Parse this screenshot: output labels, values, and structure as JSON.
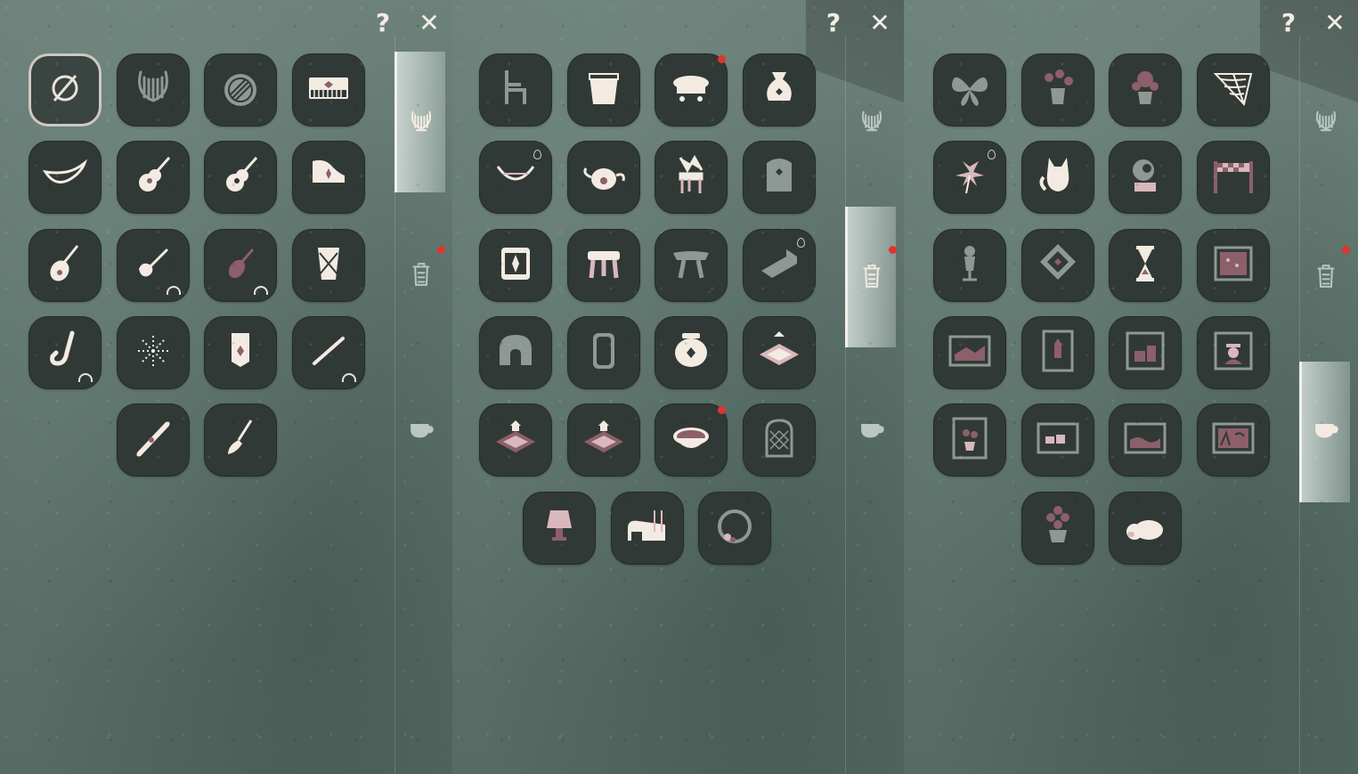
{
  "colors": {
    "background": "#5f756e",
    "slot": "#313936",
    "icon_light": "#f3ebe2",
    "icon_pink": "#d8b7bd",
    "icon_mauve": "#8c5f6b",
    "notification": "#e0342e"
  },
  "panels": [
    {
      "help_label": "?",
      "close_label": "✕",
      "active_tab": 0,
      "tabs": [
        {
          "icon": "lyre-icon",
          "notification": false
        },
        {
          "icon": "trash-can-icon",
          "notification": true
        },
        {
          "icon": "teacup-icon",
          "notification": false
        }
      ],
      "items": [
        {
          "icon": "none-icon",
          "selected": true
        },
        {
          "icon": "lyre-icon"
        },
        {
          "icon": "drum-icon"
        },
        {
          "icon": "keyboard-icon"
        },
        {
          "icon": "horn-icon"
        },
        {
          "icon": "guitar-icon"
        },
        {
          "icon": "guitar-icon"
        },
        {
          "icon": "grand-piano-icon"
        },
        {
          "icon": "pipa-icon"
        },
        {
          "icon": "electric-guitar-icon",
          "corner_mark": true
        },
        {
          "icon": "violin-icon",
          "corner_mark": true
        },
        {
          "icon": "hand-drum-icon"
        },
        {
          "icon": "saxophone-icon",
          "corner_mark": true
        },
        {
          "icon": "firework-icon"
        },
        {
          "icon": "lantern-icon"
        },
        {
          "icon": "flute-icon",
          "corner_mark": true
        },
        {
          "icon": "snowboard-icon"
        },
        {
          "icon": "broom-icon"
        }
      ]
    },
    {
      "help_label": "?",
      "close_label": "✕",
      "active_tab": 1,
      "tabs": [
        {
          "icon": "lyre-icon",
          "notification": false
        },
        {
          "icon": "trash-can-icon",
          "notification": true
        },
        {
          "icon": "teacup-icon",
          "notification": false
        }
      ],
      "items": [
        {
          "icon": "chair-icon"
        },
        {
          "icon": "cup-icon"
        },
        {
          "icon": "table-icon",
          "notification": true
        },
        {
          "icon": "sack-icon"
        },
        {
          "icon": "hammock-icon",
          "drop": true
        },
        {
          "icon": "teapot-icon",
          "sun_mark": true
        },
        {
          "icon": "ornate-chair-icon"
        },
        {
          "icon": "cabinet-icon"
        },
        {
          "icon": "barrel-drum-icon"
        },
        {
          "icon": "stool-icon"
        },
        {
          "icon": "bench-icon"
        },
        {
          "icon": "bed-frame-icon",
          "drop": true
        },
        {
          "icon": "igloo-icon"
        },
        {
          "icon": "mirror-icon"
        },
        {
          "icon": "jar-icon"
        },
        {
          "icon": "cushion-up-icon"
        },
        {
          "icon": "box-up-icon"
        },
        {
          "icon": "box-up-icon"
        },
        {
          "icon": "bowl-icon",
          "notification": true
        },
        {
          "icon": "arched-window-icon"
        },
        {
          "icon": "lamp-icon"
        },
        {
          "icon": "bed-icon"
        },
        {
          "icon": "wreath-icon"
        }
      ]
    },
    {
      "help_label": "?",
      "close_label": "✕",
      "active_tab": 2,
      "tabs": [
        {
          "icon": "lyre-icon",
          "notification": false
        },
        {
          "icon": "trash-can-icon",
          "notification": true
        },
        {
          "icon": "teacup-icon",
          "notification": false
        }
      ],
      "items": [
        {
          "icon": "butterfly-icon"
        },
        {
          "icon": "flower-vase-icon"
        },
        {
          "icon": "sunflower-vase-icon"
        },
        {
          "icon": "spiderweb-icon"
        },
        {
          "icon": "pinwheel-icon",
          "drop": true
        },
        {
          "icon": "fox-icon"
        },
        {
          "icon": "gramophone-icon"
        },
        {
          "icon": "banner-icon"
        },
        {
          "icon": "mannequin-icon"
        },
        {
          "icon": "diamond-sign-icon"
        },
        {
          "icon": "hourglass-icon"
        },
        {
          "icon": "painting-icon"
        },
        {
          "icon": "painting-icon"
        },
        {
          "icon": "painting-icon"
        },
        {
          "icon": "painting-icon"
        },
        {
          "icon": "portrait-icon"
        },
        {
          "icon": "painting-icon"
        },
        {
          "icon": "painting-icon"
        },
        {
          "icon": "painting-icon"
        },
        {
          "icon": "painting-icon"
        },
        {
          "icon": "potted-flower-icon"
        },
        {
          "icon": "sleeping-creature-icon"
        }
      ]
    }
  ]
}
